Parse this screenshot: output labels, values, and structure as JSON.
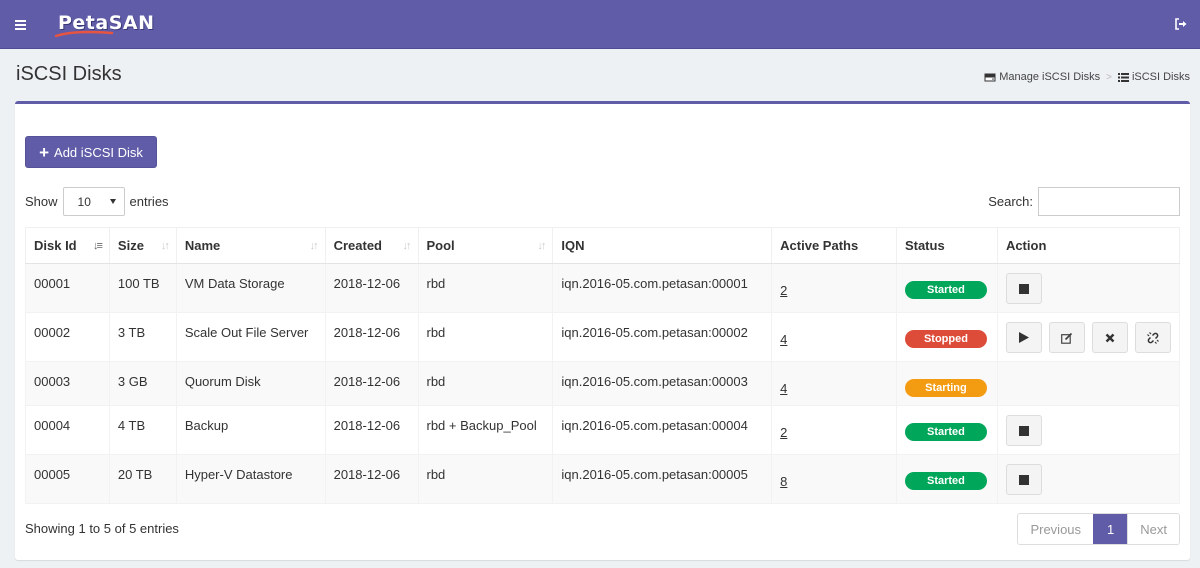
{
  "app": {
    "name": "PetaSAN",
    "colors": {
      "brand": "#605ca8",
      "started": "#00a65a",
      "stopped": "#dd4b39",
      "starting": "#f39c12"
    }
  },
  "header": {
    "menu_icon": "hamburger-icon",
    "logout_icon": "sign-out-icon"
  },
  "page": {
    "title": "iSCSI Disks",
    "breadcrumb": [
      {
        "icon": "hdd-icon",
        "label": "Manage iSCSI Disks"
      },
      {
        "icon": "list-icon",
        "label": "iSCSI Disks"
      }
    ],
    "breadcrumb_separator": ">"
  },
  "toolbar": {
    "add_label": "Add iSCSI Disk",
    "add_icon": "plus-icon"
  },
  "table_controls": {
    "show_label": "Show",
    "entries_label": "entries",
    "page_length": "10",
    "search_label": "Search:",
    "search_value": ""
  },
  "table": {
    "columns": [
      "Disk Id",
      "Size",
      "Name",
      "Created",
      "Pool",
      "IQN",
      "Active Paths",
      "Status",
      "Action"
    ],
    "rows": [
      {
        "id": "00001",
        "size": "100 TB",
        "name": "VM Data Storage",
        "created": "2018-12-06",
        "pool": "rbd",
        "iqn": "iqn.2016-05.com.petasan:00001",
        "paths": "2",
        "status": "Started",
        "status_color": "#00a65a",
        "actions": [
          "stop-icon"
        ]
      },
      {
        "id": "00002",
        "size": "3 TB",
        "name": "Scale Out File Server",
        "created": "2018-12-06",
        "pool": "rbd",
        "iqn": "iqn.2016-05.com.petasan:00002",
        "paths": "4",
        "status": "Stopped",
        "status_color": "#dd4b39",
        "actions": [
          "play-icon",
          "edit-icon",
          "delete-icon",
          "detach-icon"
        ]
      },
      {
        "id": "00003",
        "size": "3 GB",
        "name": "Quorum Disk",
        "created": "2018-12-06",
        "pool": "rbd",
        "iqn": "iqn.2016-05.com.petasan:00003",
        "paths": "4",
        "status": "Starting",
        "status_color": "#f39c12",
        "actions": []
      },
      {
        "id": "00004",
        "size": "4 TB",
        "name": "Backup",
        "created": "2018-12-06",
        "pool": "rbd + Backup_Pool",
        "iqn": "iqn.2016-05.com.petasan:00004",
        "paths": "2",
        "status": "Started",
        "status_color": "#00a65a",
        "actions": [
          "stop-icon"
        ]
      },
      {
        "id": "00005",
        "size": "20 TB",
        "name": "Hyper-V Datastore",
        "created": "2018-12-06",
        "pool": "rbd",
        "iqn": "iqn.2016-05.com.petasan:00005",
        "paths": "8",
        "status": "Started",
        "status_color": "#00a65a",
        "actions": [
          "stop-icon"
        ]
      }
    ]
  },
  "footer": {
    "info": "Showing 1 to 5 of 5 entries",
    "pagination": {
      "previous": "Previous",
      "current": "1",
      "next": "Next"
    }
  }
}
